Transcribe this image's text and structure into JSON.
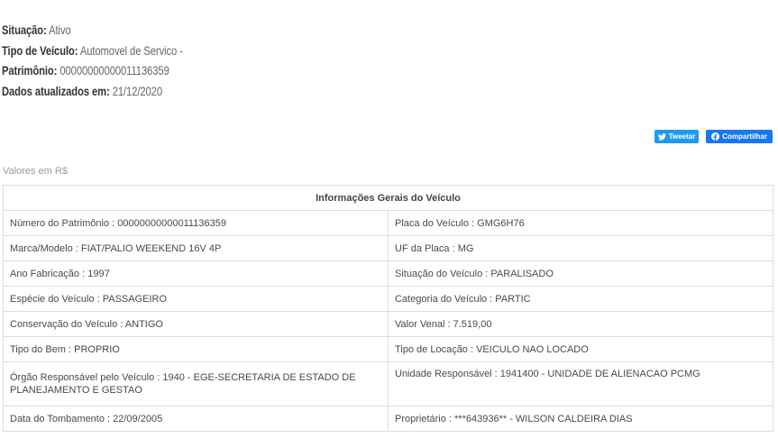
{
  "status": {
    "situacao_label": "Situação:",
    "situacao_value": "Ativo",
    "tipo_label": "Tipo de Veículo:",
    "tipo_value": "Automovel de Servico -",
    "patrimonio_label": "Patrimônio:",
    "patrimonio_value": "00000000000011136359",
    "atualizado_label": "Dados atualizados em:",
    "atualizado_value": "21/12/2020"
  },
  "share": {
    "tweet_label": "Tweetar",
    "share_label": "Compartilhar",
    "tweet_color": "#1d9bf0",
    "facebook_color": "#1877f2"
  },
  "values_note": "Valores em R$",
  "table": {
    "header": "Informações Gerais do Veículo",
    "rows": [
      [
        "Número do Patrimônio : 00000000000011136359",
        "Placa do Veículo : GMG6H76"
      ],
      [
        "Marca/Modelo : FIAT/PALIO WEEKEND 16V 4P",
        "UF da Placa : MG"
      ],
      [
        "Ano Fabricação : 1997",
        "Situação do Veículo : PARALISADO"
      ],
      [
        "Espécie do Veículo : PASSAGEIRO",
        "Categoria do Veículo : PARTIC"
      ],
      [
        "Conservação do Veículo : ANTIGO",
        "Valor Venal : 7.519,00"
      ],
      [
        "Tipo do Bem : PROPRIO",
        "Tipo de Locação : VEICULO NAO LOCADO"
      ],
      [
        "Órgão Responsável pelo Veículo : 1940 - EGE-SECRETARIA DE ESTADO DE PLANEJAMENTO E GESTAO",
        "Unidade Responsável : 1941400 - UNIDADE DE ALIENACAO PCMG"
      ],
      [
        "Data do Tombamento : 22/09/2005",
        "Proprietário : ***643936** - WILSON CALDEIRA DIAS"
      ]
    ]
  }
}
